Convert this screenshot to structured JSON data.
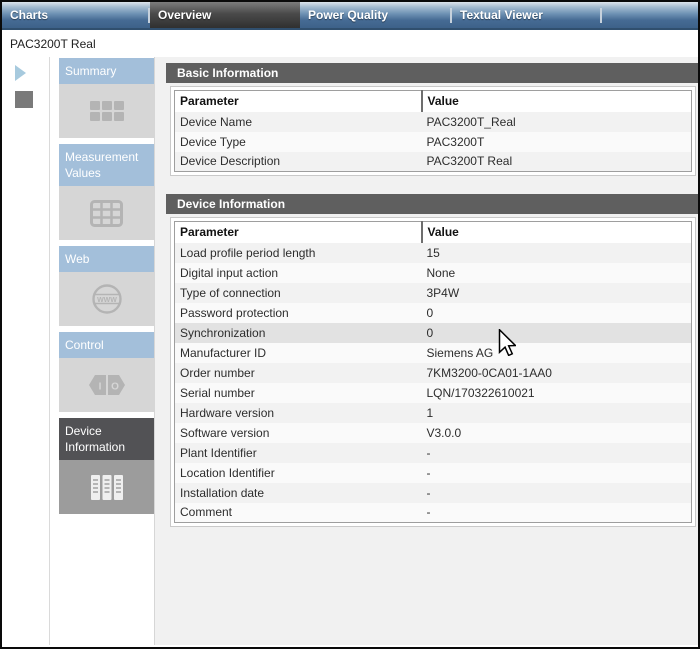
{
  "tabbar": {
    "tabs": [
      {
        "label": "Charts",
        "active": false
      },
      {
        "label": "Overview",
        "active": true
      },
      {
        "label": "Power Quality",
        "active": false
      },
      {
        "label": "Textual Viewer",
        "active": false
      }
    ]
  },
  "header": {
    "device_title": "PAC3200T Real"
  },
  "sidebar": {
    "items": [
      {
        "label": "Summary",
        "icon": "summary-grid-icon",
        "selected": false
      },
      {
        "label": "Measurement Values",
        "icon": "measurement-table-icon",
        "selected": false
      },
      {
        "label": "Web",
        "icon": "globe-www-icon",
        "selected": false
      },
      {
        "label": "Control",
        "icon": "io-icon",
        "selected": false
      },
      {
        "label": "Device Information",
        "icon": "device-documents-icon",
        "selected": true
      }
    ],
    "web_icon_text": "WWW",
    "io_icon_input_label": "I",
    "io_icon_output_label": "O"
  },
  "sections": [
    {
      "title": "Basic Information",
      "columns": {
        "parameter": "Parameter",
        "value": "Value"
      },
      "rows": [
        {
          "parameter": "Device Name",
          "value": "PAC3200T_Real"
        },
        {
          "parameter": "Device Type",
          "value": "PAC3200T"
        },
        {
          "parameter": "Device Description",
          "value": "PAC3200T Real"
        }
      ]
    },
    {
      "title": "Device Information",
      "columns": {
        "parameter": "Parameter",
        "value": "Value"
      },
      "rows": [
        {
          "parameter": "Load profile period length",
          "value": "15"
        },
        {
          "parameter": "Digital input action",
          "value": "None"
        },
        {
          "parameter": "Type of connection",
          "value": "3P4W"
        },
        {
          "parameter": "Password protection",
          "value": "0"
        },
        {
          "parameter": "Synchronization",
          "value": "0",
          "state": "hovered"
        },
        {
          "parameter": "Manufacturer ID",
          "value": "Siemens AG"
        },
        {
          "parameter": "Order number",
          "value": "7KM3200-0CA01-1AA0"
        },
        {
          "parameter": "Serial number",
          "value": "LQN/170322610021"
        },
        {
          "parameter": "Hardware version",
          "value": "1"
        },
        {
          "parameter": "Software version",
          "value": "V3.0.0"
        },
        {
          "parameter": "Plant Identifier",
          "value": "-"
        },
        {
          "parameter": "Location Identifier",
          "value": "-"
        },
        {
          "parameter": "Installation date",
          "value": "-"
        },
        {
          "parameter": "Comment",
          "value": "-"
        }
      ]
    }
  ],
  "colors": {
    "tabbar_blue": "#466b94",
    "tab_active_dark": "#303030",
    "nav_header_blue": "#a3bfda",
    "nav_selected_gray": "#525255",
    "section_bar_gray": "#5f5f5f",
    "page_background": "#f1f1f1",
    "row_hover": "#e2e2e2",
    "icon_gray": "#b4b4b4"
  }
}
